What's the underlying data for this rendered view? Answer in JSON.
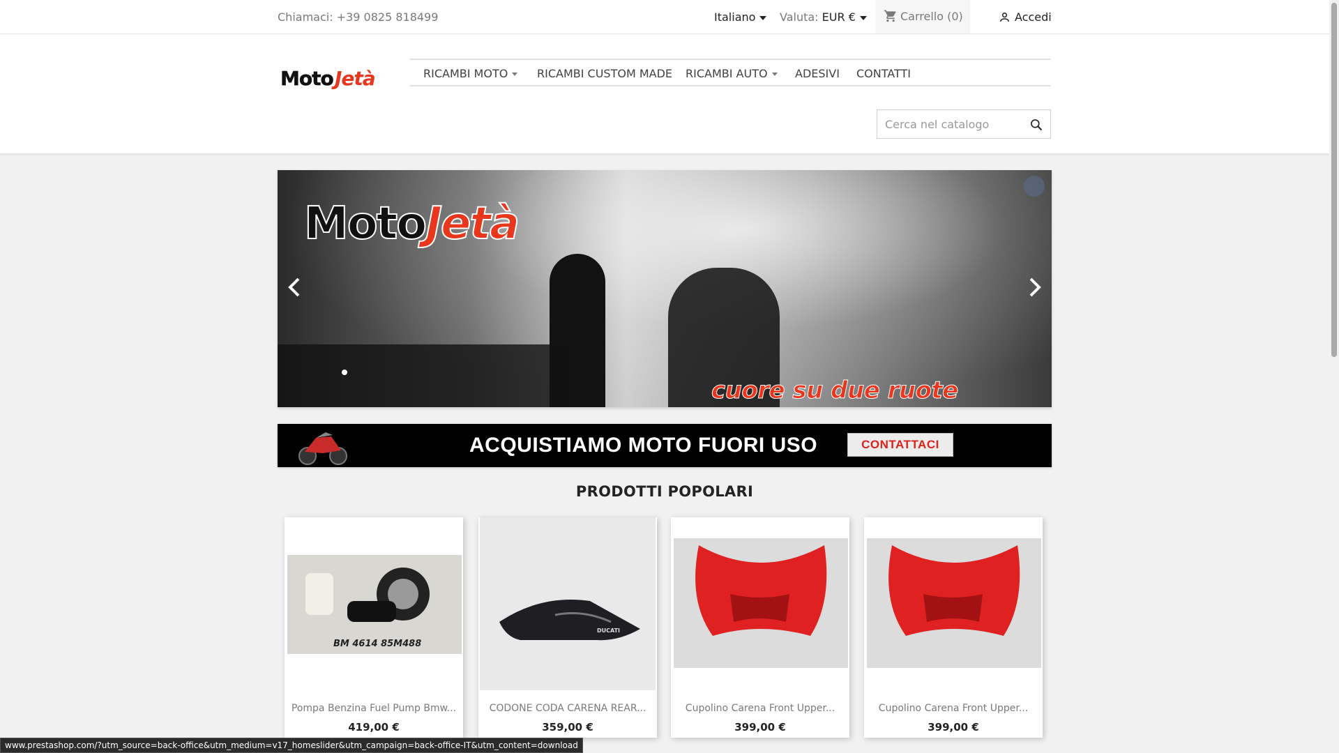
{
  "topbar": {
    "phone": "Chiamaci: +39 0825 818499",
    "language": "Italiano",
    "currency_label": "Valuta:",
    "currency_value": "EUR €",
    "cart": "Carrello (0)",
    "login": "Accedi"
  },
  "nav": {
    "items": [
      {
        "label": "RICAMBI MOTO",
        "dropdown": true
      },
      {
        "label": "RICAMBI CUSTOM MADE",
        "dropdown": false
      },
      {
        "label": "RICAMBI AUTO",
        "dropdown": true
      },
      {
        "label": "ADESIVI",
        "dropdown": false
      },
      {
        "label": "CONTATTI",
        "dropdown": false
      }
    ]
  },
  "search": {
    "placeholder": "Cerca nel catalogo"
  },
  "hero": {
    "wordmark_a": "Moto",
    "wordmark_b": "Jetà",
    "tagline": "cuore su due ruote"
  },
  "banner": {
    "headline": "ACQUISTIAMO MOTO FUORI USO",
    "cta": "CONTATTACI"
  },
  "section": {
    "title": "PRODOTTI POPOLARI"
  },
  "products": [
    {
      "name": "Pompa Benzina Fuel Pump Bmw...",
      "price": "419,00 €"
    },
    {
      "name": "CODONE CODA CARENA REAR...",
      "price": "359,00 €"
    },
    {
      "name": "Cupolino Carena Front Upper...",
      "price": "399,00 €"
    },
    {
      "name": "Cupolino Carena Front Upper...",
      "price": "399,00 €"
    }
  ],
  "status_url": "www.prestashop.com/?utm_source=back-office&utm_medium=v17_homeslider&utm_campaign=back-office-IT&utm_content=download",
  "colors": {
    "brand_red": "#e8371d",
    "page_bg": "#f1f1f1",
    "text_dark": "#232323",
    "text_muted": "#7a7a7a"
  }
}
